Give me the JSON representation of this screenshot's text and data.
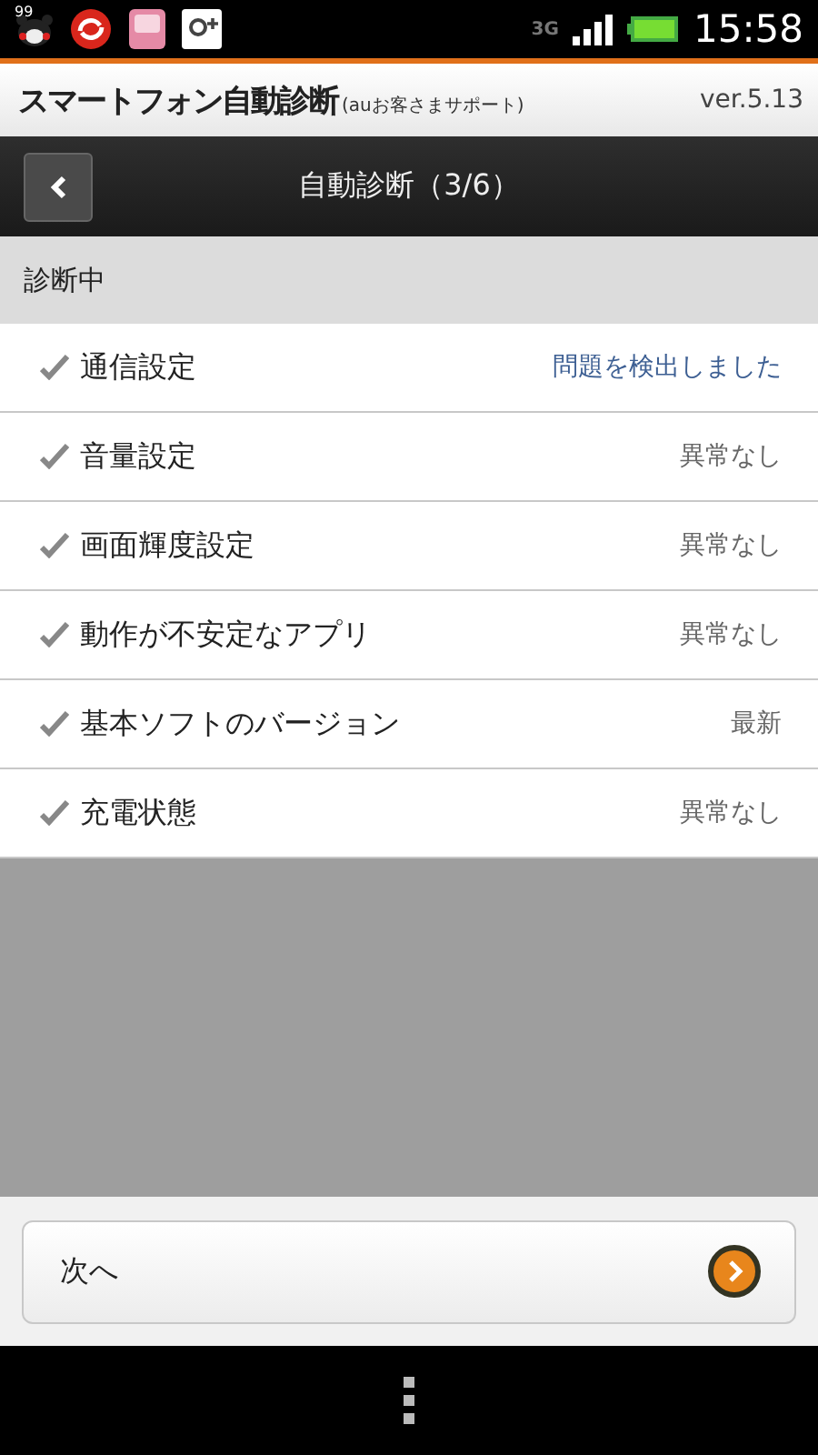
{
  "status_bar": {
    "badge": "99",
    "network": "3G",
    "time": "15:58"
  },
  "app_header": {
    "title": "スマートフォン自動診断",
    "subtitle": "(auお客さまサポート)",
    "version": "ver.5.13"
  },
  "nav_bar": {
    "title": "自動診断（3/6）"
  },
  "section": {
    "title": "診断中"
  },
  "items": [
    {
      "label": "通信設定",
      "result": "問題を検出しました",
      "kind": "issue",
      "checked": true
    },
    {
      "label": "音量設定",
      "result": "異常なし",
      "kind": "normal",
      "checked": true
    },
    {
      "label": "画面輝度設定",
      "result": "異常なし",
      "kind": "normal",
      "checked": true
    },
    {
      "label": "動作が不安定なアプリ",
      "result": "異常なし",
      "kind": "normal",
      "checked": true
    },
    {
      "label": "基本ソフトのバージョン",
      "result": "最新",
      "kind": "normal",
      "checked": true
    },
    {
      "label": "充電状態",
      "result": "異常なし",
      "kind": "normal",
      "checked": true
    }
  ],
  "next_button": {
    "label": "次へ"
  }
}
